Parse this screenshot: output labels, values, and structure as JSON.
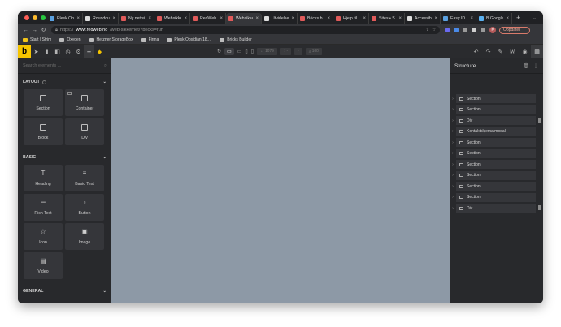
{
  "colors": {
    "accent": "#f5c400",
    "canvas": "#8d99a6",
    "panel": "#28292c",
    "chrome": "#202124"
  },
  "tabs": [
    {
      "label": "Plesk Ob",
      "fav": "#5aa0e0"
    },
    {
      "label": "Roundcu",
      "fav": "#dddddd"
    },
    {
      "label": "Ny nettsi",
      "fav": "#e05a5a"
    },
    {
      "label": "Websikke",
      "fav": "#e05a5a"
    },
    {
      "label": "RedWeb",
      "fav": "#e05a5a"
    },
    {
      "label": "Websikke",
      "fav": "#e05a5a",
      "active": true
    },
    {
      "label": "Utvidelse",
      "fav": "#dddddd"
    },
    {
      "label": "Bricks b",
      "fav": "#e05a5a"
    },
    {
      "label": "Hjelp til",
      "fav": "#e05a5a"
    },
    {
      "label": "Sites • S",
      "fav": "#e05a5a"
    },
    {
      "label": "Accessib",
      "fav": "#dddddd"
    },
    {
      "label": "Easy ID",
      "fav": "#5aa0e0"
    },
    {
      "label": "B Google",
      "fav": "#5ab0f0"
    }
  ],
  "address": {
    "scheme": "https://",
    "host": "www.redweb.no",
    "path": "/web-sikkerhet/?bricks=run"
  },
  "update_label": "Oppdater",
  "avatar_letter": "P",
  "bookmarks": [
    "Start | Strim",
    "Oxygen",
    "Hetzner StorageBox",
    "Firma",
    "Plesk Obsidian 18....",
    "Bricks Builder"
  ],
  "toolbar": {
    "logo": "b",
    "width_value": "1079",
    "zoom_value": "100"
  },
  "search_placeholder": "Search elements ...",
  "categories": {
    "layout": {
      "title": "LAYOUT",
      "items": [
        {
          "label": "Section",
          "icon": "section-icon"
        },
        {
          "label": "Container",
          "icon": "container-icon"
        },
        {
          "label": "Block",
          "icon": "block-icon"
        },
        {
          "label": "Div",
          "icon": "div-icon"
        }
      ]
    },
    "basic": {
      "title": "BASIC",
      "items": [
        {
          "label": "Heading",
          "icon": "heading-icon",
          "glyph": "T"
        },
        {
          "label": "Basic Text",
          "icon": "basic-text-icon",
          "glyph": "≡"
        },
        {
          "label": "Rich Text",
          "icon": "rich-text-icon",
          "glyph": "☰"
        },
        {
          "label": "Button",
          "icon": "button-icon",
          "glyph": "▫"
        },
        {
          "label": "Icon",
          "icon": "star-icon",
          "glyph": "☆"
        },
        {
          "label": "Image",
          "icon": "image-icon",
          "glyph": "▣"
        },
        {
          "label": "Video",
          "icon": "video-icon",
          "glyph": "▤"
        }
      ]
    },
    "general": {
      "title": "GENERAL"
    }
  },
  "structure": {
    "title": "Structure",
    "items": [
      "Section",
      "Section",
      "Div",
      "Kontaktskjema modal",
      "Section",
      "Section",
      "Section",
      "Section",
      "Section",
      "Section",
      "Div"
    ]
  }
}
